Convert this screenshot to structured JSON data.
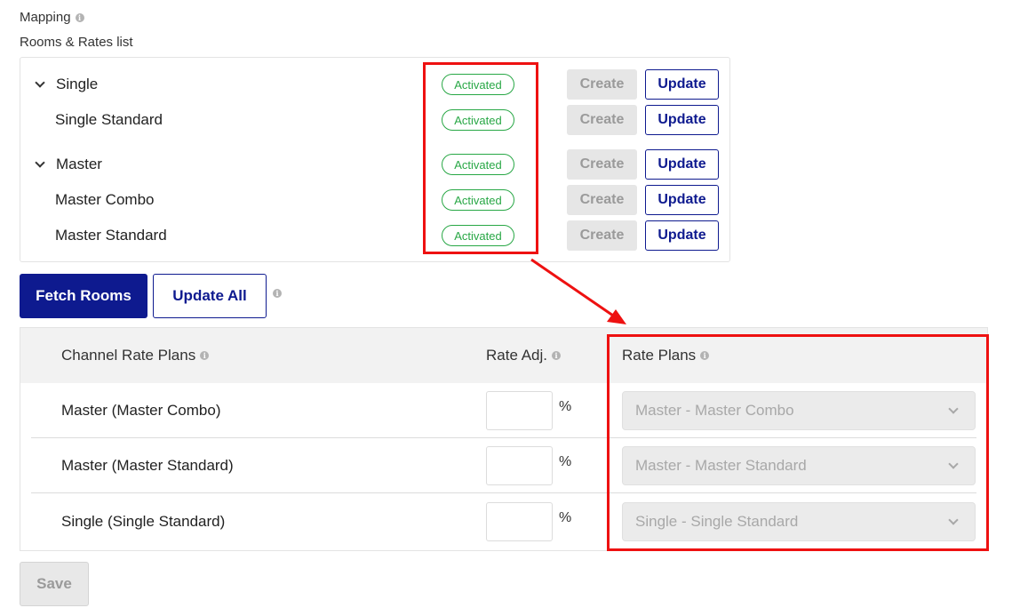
{
  "header": {
    "mapping_label": "Mapping",
    "rooms_rates_label": "Rooms & Rates list"
  },
  "rooms": [
    {
      "name": "Single",
      "group": true,
      "status": "Activated",
      "create_label": "Create",
      "update_label": "Update"
    },
    {
      "name": "Single Standard",
      "group": false,
      "status": "Activated",
      "create_label": "Create",
      "update_label": "Update"
    },
    {
      "name": "Master",
      "group": true,
      "status": "Activated",
      "create_label": "Create",
      "update_label": "Update"
    },
    {
      "name": "Master Combo",
      "group": false,
      "status": "Activated",
      "create_label": "Create",
      "update_label": "Update"
    },
    {
      "name": "Master Standard",
      "group": false,
      "status": "Activated",
      "create_label": "Create",
      "update_label": "Update"
    }
  ],
  "actions": {
    "fetch_rooms": "Fetch Rooms",
    "update_all": "Update All",
    "save": "Save"
  },
  "plans_table": {
    "headers": {
      "channel_rate_plans": "Channel Rate Plans",
      "rate_adj": "Rate Adj.",
      "rate_plans": "Rate Plans"
    },
    "rows": [
      {
        "channel_plan": "Master (Master Combo)",
        "rate_adj": "",
        "unit": "%",
        "rate_plan": "Master - Master Combo"
      },
      {
        "channel_plan": "Master (Master Standard)",
        "rate_adj": "",
        "unit": "%",
        "rate_plan": "Master - Master Standard"
      },
      {
        "channel_plan": "Single (Single Standard)",
        "rate_adj": "",
        "unit": "%",
        "rate_plan": "Single - Single Standard"
      }
    ]
  },
  "colors": {
    "primary": "#0e1a8f",
    "success": "#28a745",
    "highlight": "#ee1111",
    "disabled_bg": "#e6e6e6"
  },
  "icons": {
    "info": "info-icon",
    "expand": "chevron-down-icon",
    "select": "chevron-down-icon"
  }
}
